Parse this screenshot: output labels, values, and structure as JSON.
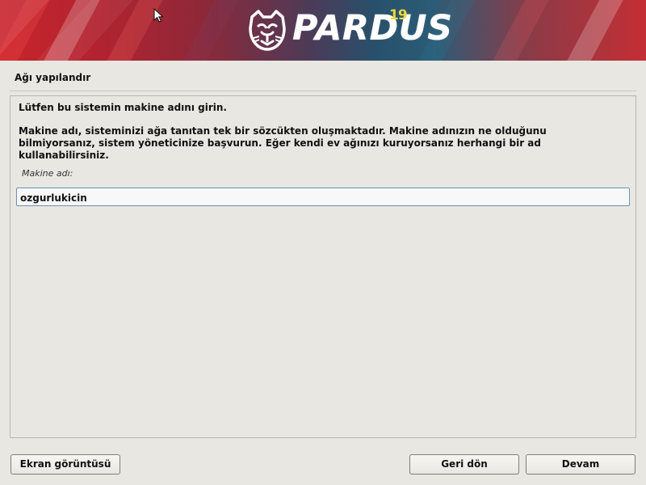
{
  "header": {
    "brand": "PARDUS",
    "version": "19",
    "logo_icon": "pardus-cat-icon",
    "cursor_icon": "mouse-cursor-icon",
    "colors": {
      "banner_red": "#c9242b",
      "banner_blue": "#2b5c77",
      "version_yellow": "#ead63e"
    }
  },
  "page": {
    "title": "Ağı yapılandır"
  },
  "content": {
    "intro": "Lütfen bu sistemin makine adını girin.",
    "help_line_1": "Makine adı, sisteminizi ağa tanıtan tek bir sözcükten oluşmaktadır. Makine adınızın ne olduğunu",
    "help_line_2": "bilmiyorsanız, sistem yöneticinize başvurun. Eğer kendi ev ağınızı kuruyorsanız herhangi bir ad",
    "help_line_3": "kullanabilirsiniz.",
    "field_label": "Makine adı:",
    "hostname_value": "ozgurlukicin"
  },
  "buttons": {
    "screenshot": "Ekran görüntüsü",
    "back": "Geri dön",
    "continue": "Devam"
  }
}
